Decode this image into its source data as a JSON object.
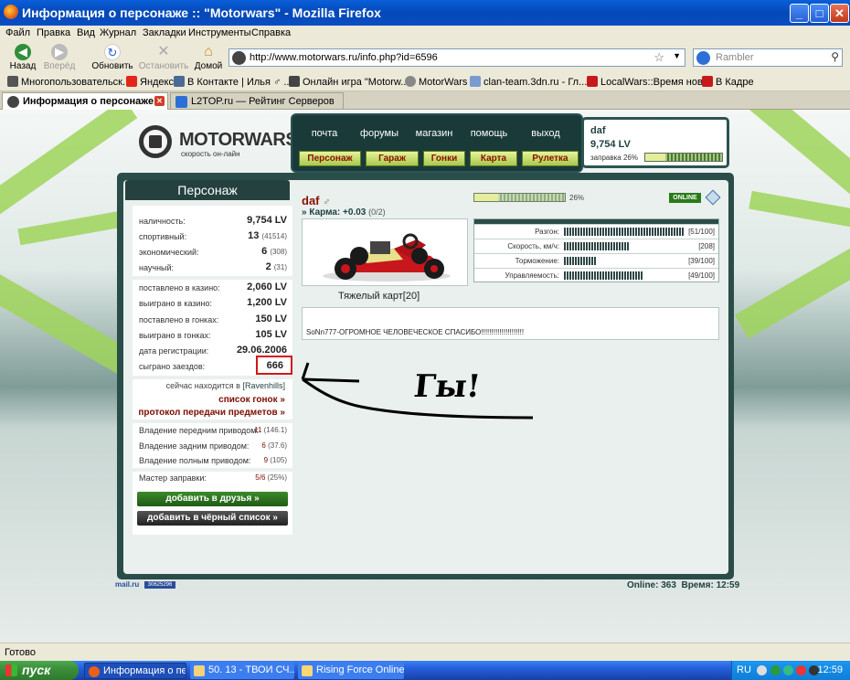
{
  "window": {
    "title": "Информация о персонаже :: \"Motorwars\" - Mozilla Firefox",
    "min": "_",
    "max": "□",
    "close": "✕"
  },
  "menu": [
    "Файл",
    "Правка",
    "Вид",
    "Журнал",
    "Закладки",
    "Инструменты",
    "Справка"
  ],
  "nav": {
    "back": "Назад",
    "forward": "Вперёд",
    "reload": "Обновить",
    "stop": "Остановить",
    "home": "Домой",
    "url": "http://www.motorwars.ru/info.php?id=6596",
    "search_placeholder": "Rambler"
  },
  "bookmarks": [
    "Многопользовательск...",
    "Яндекс",
    "В Контакте | Илья ♂ ...",
    "Онлайн игра \"Motorw...",
    "MotorWars",
    "clan-team.3dn.ru - Гл...",
    "LocalWars::Время нов...",
    "В Кадре"
  ],
  "tabs": [
    {
      "label": "Информация о персонаже ..."
    },
    {
      "label": "L2TOP.ru — Рейтинг Серверов ..."
    }
  ],
  "site": {
    "logo_name": "MOTORWARS.RU",
    "logo_sub": "скорость он-лайн",
    "topnav": [
      "почта",
      "форумы",
      "магазин",
      "помощь",
      "выход"
    ],
    "mainnav": [
      "Персонаж",
      "Гараж",
      "Гонки",
      "Карта",
      "Рулетка"
    ],
    "user": {
      "name": "daf",
      "money": "9,754 LV",
      "refuel_label": "заправка 26%",
      "refuel_level": 0.26
    }
  },
  "panel": {
    "heading": "Персонаж",
    "stats": [
      {
        "label": "наличность:",
        "value": "9,754 LV",
        "extra": ""
      },
      {
        "label": "спортивный:",
        "value": "13",
        "extra": "(41514)"
      },
      {
        "label": "экономический:",
        "value": "6",
        "extra": "(308)"
      },
      {
        "label": "научный:",
        "value": "2",
        "extra": "(31)"
      }
    ],
    "casino": [
      {
        "label": "поставлено в казино:",
        "value": "2,060 LV"
      },
      {
        "label": "выиграно в казино:",
        "value": "1,200 LV"
      },
      {
        "label": "поставлено в гонках:",
        "value": "150 LV"
      },
      {
        "label": "выиграно в гонках:",
        "value": "105 LV"
      },
      {
        "label": "дата регистрации:",
        "value": "29.06.2006"
      },
      {
        "label": "сыграно заездов:",
        "value": "666"
      }
    ],
    "location_text": "сейчас находится в",
    "location_value": "[Ravenhills]",
    "races_link": "список гонок »",
    "protocol_link": "протокол передачи предметов »",
    "drive": [
      {
        "label": "Владение передним приводом:",
        "value": "11",
        "extra": "(146.1)"
      },
      {
        "label": "Владение задним приводом:",
        "value": "6",
        "extra": "(37.6)"
      },
      {
        "label": "Владение полным приводом:",
        "value": "9",
        "extra": "(105)"
      }
    ],
    "refuel_master": {
      "label": "Мастер заправки:",
      "value": "5/6",
      "extra": "(25%)"
    },
    "add_friend": "добавить в друзья »",
    "add_black": "добавить в чёрный список »"
  },
  "profile": {
    "name": "daf",
    "sex_icon": "♂",
    "karma_label": "» Карма:",
    "karma_value": "+0.03",
    "karma_extra": "(0/2)",
    "xp_text": "26%",
    "xp_level": 0.26,
    "status": "ONLINE",
    "car_name": "Тяжелый карт[20]",
    "car_stats": [
      {
        "label": "Разгон:",
        "value": "[51/100]"
      },
      {
        "label": "Скорость, км/ч:",
        "value": "[208]"
      },
      {
        "label": "Торможение:",
        "value": "[39/100]"
      },
      {
        "label": "Управляемость:",
        "value": "[49/100]"
      }
    ],
    "message": "SoNn777-ОГРОМНОЕ ЧЕЛОВЕЧЕСКОЕ СПАСИБО!!!!!!!!!!!!!!!!!!!!!"
  },
  "annotation": "Гы!",
  "footer": {
    "mailru": "mail.ru",
    "counter": "30625296",
    "online": "Online: 363",
    "time": "Время: 12:59"
  },
  "status_text": "Готово",
  "taskbar": {
    "start": "пуск",
    "items": [
      "Информация о пе...",
      "50. 13 - ТВОИ СЧ...",
      "Rising Force Online"
    ],
    "lang": "RU",
    "clock": "12:59"
  },
  "colors": {
    "panel": "#2b4d4a",
    "accent_red": "#8a0f00",
    "highlight": "#d41515"
  }
}
